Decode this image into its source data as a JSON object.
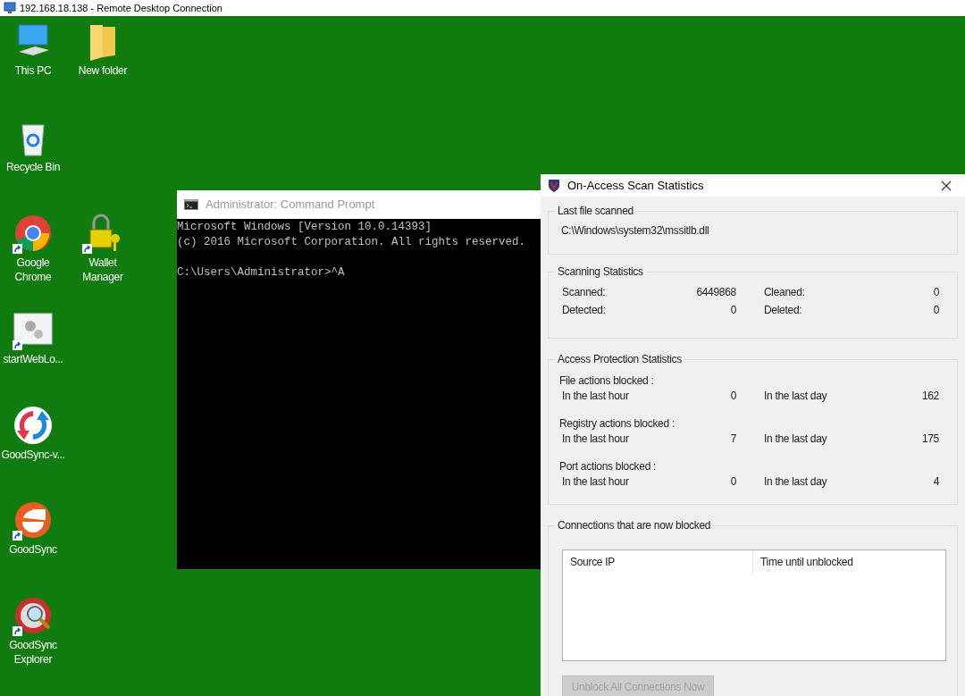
{
  "remote_title_bar": {
    "title": "192.168.18.138 - Remote Desktop Connection"
  },
  "desktop_icons": [
    {
      "label": "This PC",
      "kind": "computer",
      "shortcut": false
    },
    {
      "label": "New folder",
      "kind": "folder",
      "shortcut": false
    },
    {
      "label": "Recycle Bin",
      "kind": "recycle-bin",
      "shortcut": false
    },
    {
      "label": "Google Chrome",
      "kind": "browser",
      "shortcut": true
    },
    {
      "label": "Wallet Manager",
      "kind": "padlock",
      "shortcut": true
    },
    {
      "label": "startWebLo...",
      "kind": "gears",
      "shortcut": true
    },
    {
      "label": "GoodSync-v...",
      "kind": "sync-arrows",
      "shortcut": false
    },
    {
      "label": "GoodSync",
      "kind": "sync-circle",
      "shortcut": true
    },
    {
      "label": "GoodSync Explorer",
      "kind": "sync-search",
      "shortcut": true
    }
  ],
  "command_prompt": {
    "title": "Administrator: Command Prompt",
    "output": [
      "Microsoft Windows [Version 10.0.14393]",
      "(c) 2016 Microsoft Corporation. All rights reserved."
    ],
    "prompt": "C:\\Users\\Administrator>^A"
  },
  "scan_statistics": {
    "title": "On-Access Scan Statistics",
    "last_file": {
      "heading": "Last file scanned",
      "path": "C:\\Windows\\system32\\mssitlb.dll"
    },
    "scanning": {
      "heading": "Scanning Statistics",
      "rows": [
        {
          "label_1": "Scanned:",
          "value_1": "6449868",
          "label_2": "Cleaned:",
          "value_2": "0"
        },
        {
          "label_1": "Detected:",
          "value_1": "0",
          "label_2": "Deleted:",
          "value_2": "0"
        }
      ]
    },
    "access_protection": {
      "heading": "Access Protection Statistics",
      "groups": [
        {
          "title": "File actions blocked :",
          "hour_label": "In the last hour",
          "hour_value": "0",
          "day_label": "In the last day",
          "day_value": "162"
        },
        {
          "title": "Registry actions blocked :",
          "hour_label": "In the last hour",
          "hour_value": "7",
          "day_label": "In the last day",
          "day_value": "175"
        },
        {
          "title": "Port actions blocked :",
          "hour_label": "In the last hour",
          "hour_value": "0",
          "day_label": "In the last day",
          "day_value": "4"
        }
      ]
    },
    "connections": {
      "heading": "Connections that are now blocked",
      "columns": [
        "Source IP",
        "Time until unblocked"
      ]
    },
    "unblock_button": {
      "label": "Unblock All Connections Now",
      "disabled": true
    }
  }
}
